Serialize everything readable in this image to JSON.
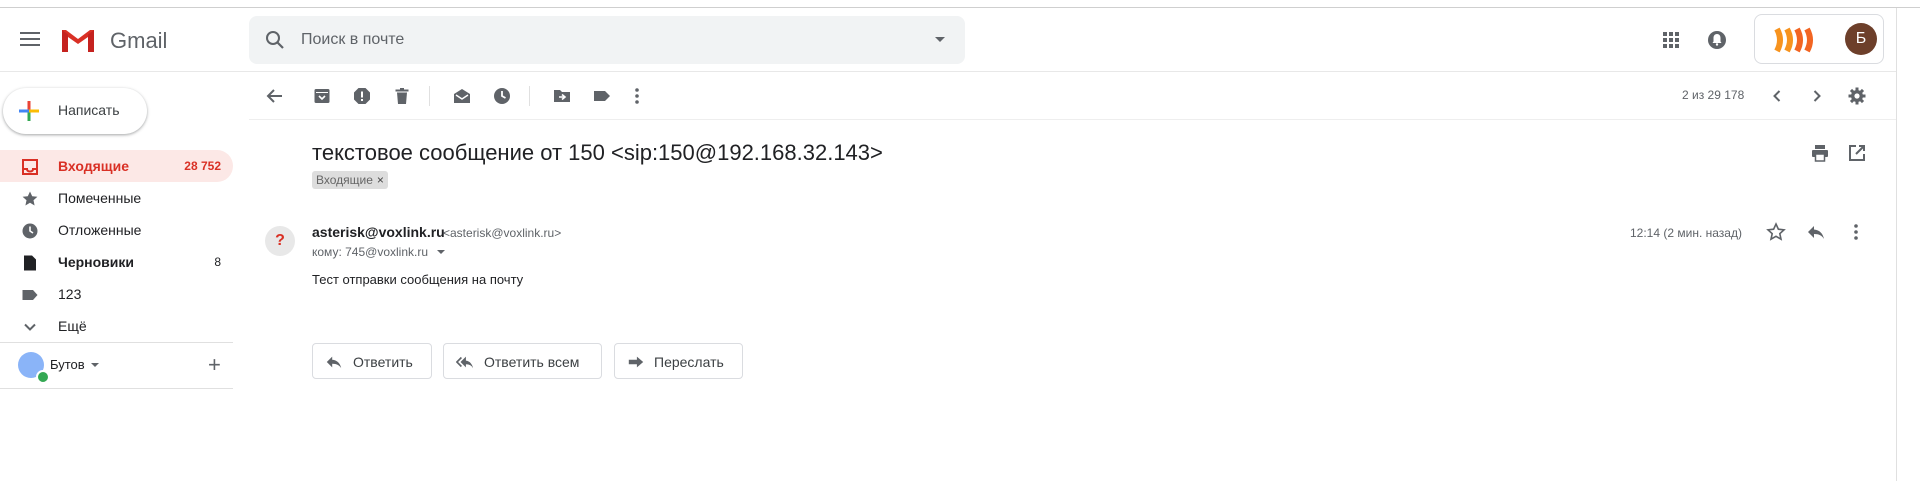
{
  "app": {
    "name": "Gmail"
  },
  "search": {
    "placeholder": "Поиск в почте"
  },
  "account": {
    "initial": "Б"
  },
  "compose": {
    "label": "Написать"
  },
  "sidebar": {
    "items": [
      {
        "label": "Входящие",
        "count": "28 752",
        "icon": "inbox-icon"
      },
      {
        "label": "Помеченные",
        "count": "",
        "icon": "star-icon"
      },
      {
        "label": "Отложенные",
        "count": "",
        "icon": "clock-icon"
      },
      {
        "label": "Черновики",
        "count": "8",
        "icon": "draft-icon"
      },
      {
        "label": "123",
        "count": "",
        "icon": "label-icon"
      },
      {
        "label": "Ещё",
        "count": "",
        "icon": "chevron-down-icon"
      }
    ],
    "hangouts_user": "Бутов"
  },
  "toolbar": {
    "pager": "2 из 29 178"
  },
  "message": {
    "subject": "текстовое сообщение от 150 <sip:150@192.168.32.143>",
    "label_chip": "Входящие",
    "label_chip_remove": "×",
    "sender_avatar": "?",
    "sender_name": "asterisk@voxlink.ru",
    "sender_address": "<asterisk@voxlink.ru>",
    "to": "кому: 745@voxlink.ru",
    "time": "12:14 (2 мин. назад)",
    "body": "Тест отправки сообщения на почту"
  },
  "actions": {
    "reply": "Ответить",
    "reply_all": "Ответить всем",
    "forward": "Переслать"
  },
  "colors": {
    "accent": "#d93025",
    "active_bg": "#fce8e6"
  }
}
